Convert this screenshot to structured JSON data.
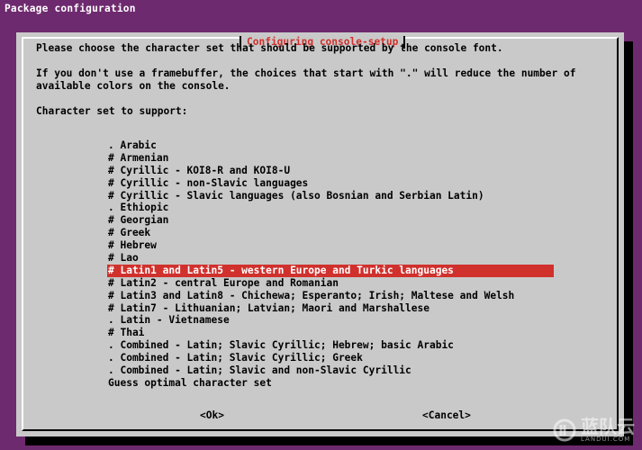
{
  "window": {
    "title": "Package configuration"
  },
  "dialog": {
    "title": "Configuring console-setup",
    "prompt_line1": "Please choose the character set that should be supported by the console font.",
    "info_line1": "If you don't use a framebuffer, the choices that start with \".\" will reduce the number of",
    "info_line2": "available colors on the console.",
    "list_label": "Character set to support:",
    "items": [
      ". Arabic",
      "# Armenian",
      "# Cyrillic - KOI8-R and KOI8-U",
      "# Cyrillic - non-Slavic languages",
      "# Cyrillic - Slavic languages (also Bosnian and Serbian Latin)",
      ". Ethiopic",
      "# Georgian",
      "# Greek",
      "# Hebrew",
      "# Lao",
      "# Latin1 and Latin5 - western Europe and Turkic languages",
      "# Latin2 - central Europe and Romanian",
      "# Latin3 and Latin8 - Chichewa; Esperanto; Irish; Maltese and Welsh",
      "# Latin7 - Lithuanian; Latvian; Maori and Marshallese",
      ". Latin - Vietnamese",
      "# Thai",
      ". Combined - Latin; Slavic Cyrillic; Hebrew; basic Arabic",
      ". Combined - Latin; Slavic Cyrillic; Greek",
      ". Combined - Latin; Slavic and non-Slavic Cyrillic",
      "Guess optimal character set"
    ],
    "selected_index": 10,
    "ok_label": "<Ok>",
    "cancel_label": "<Cancel>"
  },
  "watermark": {
    "text": "蓝队云",
    "sub": "LANDUI.COM"
  },
  "colors": {
    "background": "#6e2a6e",
    "dialog": "#c9c9c9",
    "accent": "#d0312d"
  }
}
